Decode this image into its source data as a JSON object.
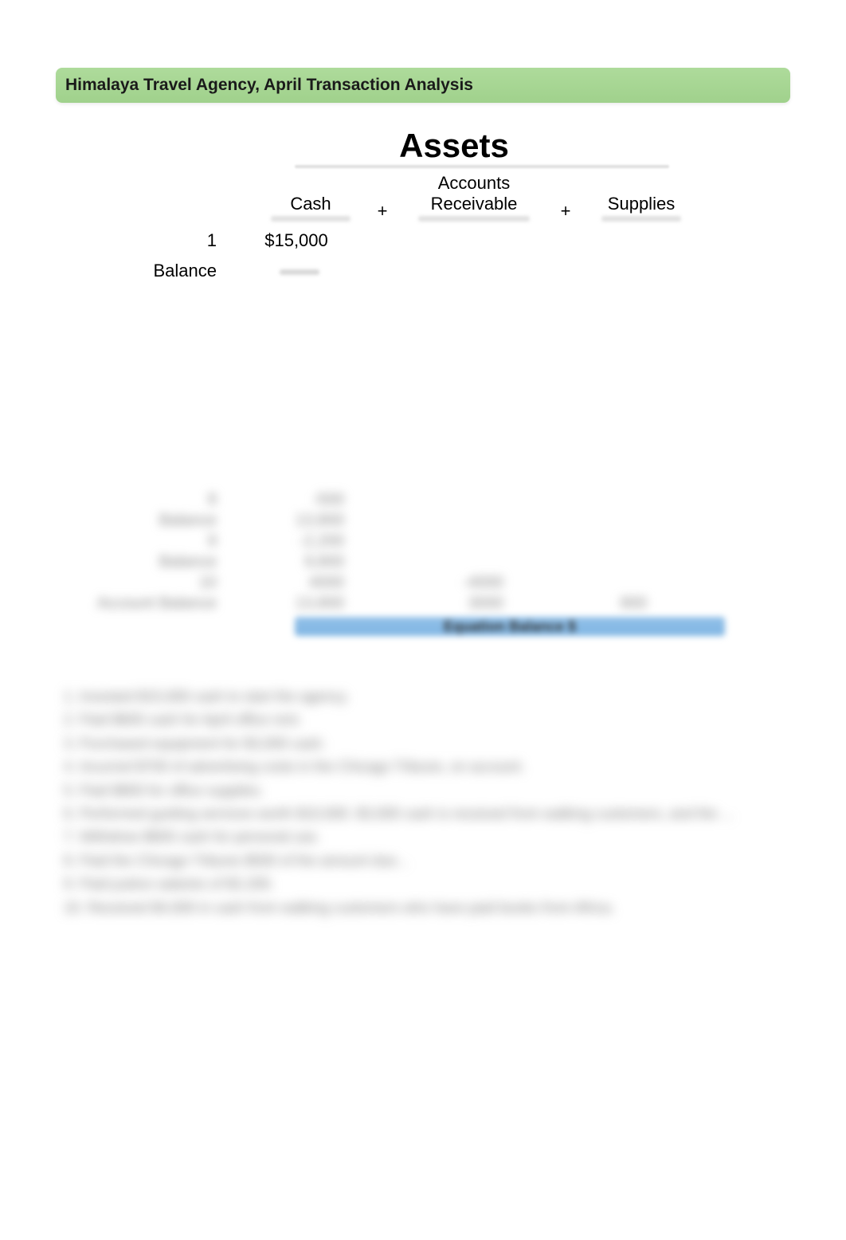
{
  "header": {
    "title": "Himalaya Travel Agency, April Transaction Analysis"
  },
  "section_heading": "Assets",
  "columns": {
    "cash": "Cash",
    "plus1": "+",
    "ar_line1": "Accounts",
    "ar_line2": "Receivable",
    "plus2": "+",
    "supplies": "Supplies"
  },
  "rows": {
    "r1": {
      "label": "1",
      "cash": "$15,000"
    },
    "r2": {
      "label": "Balance",
      "cash": ""
    }
  },
  "blurred_mid": {
    "r_a": {
      "label": "",
      "cash": ""
    },
    "r_b": {
      "label": "Balance",
      "cash": ""
    },
    "r_c": {
      "label": "",
      "cash": ""
    },
    "r_d": {
      "label": "Balance",
      "cash": ""
    },
    "r_e": {
      "label": "",
      "cash": "",
      "ar": ""
    },
    "r_f": {
      "label": "Account Balance",
      "cash": "",
      "ar": "",
      "sup": ""
    }
  },
  "equation_bar": "Equation Balance      $",
  "notes": [
    "1.  Invested $15,000 cash to start the agency.",
    "2.  Paid $600 cash for April office rent.",
    "3.  Purchased equipment for $3,000 cash.",
    "4.  Incurred $700 of advertising costs in the Chicago Tribune, on account.",
    "5.  Paid $800 for office supplies.",
    "6.  Performed guiding services worth $10,000. $3,000 cash is received from walking customers, and the ...",
    "7.  Withdrew $600 cash for personal use.",
    "8.  Paid the Chicago Tribune $500 of the amount due...",
    "9.  Paid justice salaries of $2,200.",
    "10.  Received $4,000 in cash from walking customers who have paid books from Africa."
  ]
}
